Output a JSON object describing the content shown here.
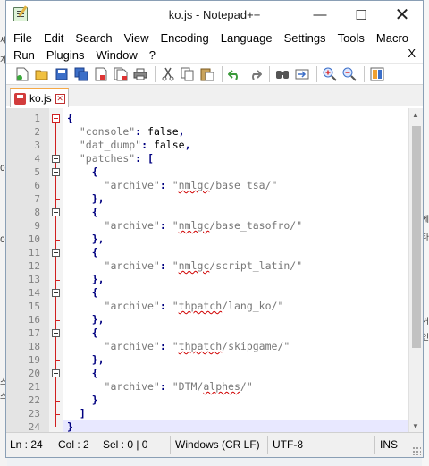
{
  "window": {
    "title": "ko.js - Notepad++"
  },
  "titlebar": {
    "min_glyph": "—",
    "max_glyph": "☐",
    "close_glyph": "✕"
  },
  "menu": {
    "row1": [
      "File",
      "Edit",
      "Search",
      "View",
      "Encoding",
      "Language",
      "Settings",
      "Tools",
      "Macro"
    ],
    "row2": [
      "Run",
      "Plugins",
      "Window",
      "?"
    ],
    "close": "X"
  },
  "toolbar": {
    "icons": [
      "new-file-icon",
      "open-file-icon",
      "save-icon",
      "save-all-icon",
      "close-icon",
      "close-all-icon",
      "print-icon",
      "cut-icon",
      "copy-icon",
      "paste-icon",
      "undo-icon",
      "redo-icon",
      "find-icon",
      "replace-icon",
      "zoom-in-icon",
      "zoom-out-icon",
      "sync-scroll-icon"
    ]
  },
  "tab": {
    "label": "ko.js"
  },
  "editor": {
    "line_numbers": [
      "1",
      "2",
      "3",
      "4",
      "5",
      "6",
      "7",
      "8",
      "9",
      "10",
      "11",
      "12",
      "13",
      "14",
      "15",
      "16",
      "17",
      "18",
      "19",
      "20",
      "21",
      "22",
      "23",
      "24"
    ],
    "lines": [
      "{",
      "  \"console\": false,",
      "  \"dat_dump\": false,",
      "  \"patches\": [",
      "    {",
      "      \"archive\": \"nmlgc/base_tsa/\"",
      "    },",
      "    {",
      "      \"archive\": \"nmlgc/base_tasofro/\"",
      "    },",
      "    {",
      "      \"archive\": \"nmlgc/script_latin/\"",
      "    },",
      "    {",
      "      \"archive\": \"thpatch/lang_ko/\"",
      "    },",
      "    {",
      "      \"archive\": \"thpatch/skipgame/\"",
      "    },",
      "    {",
      "      \"archive\": \"DTM/alphes/\"",
      "    }",
      "  ]",
      "}"
    ]
  },
  "status": {
    "line": "Ln : 24",
    "col": "Col : 2",
    "sel": "Sel : 0 | 0",
    "eol": "Windows (CR LF)",
    "encoding": "UTF-8",
    "mode": "INS"
  },
  "background_fragments": {
    "left": [
      "세",
      "계",
      "0",
      "0",
      "스",
      "스"
    ],
    "right": [
      "세",
      "타",
      "거",
      "인"
    ]
  }
}
